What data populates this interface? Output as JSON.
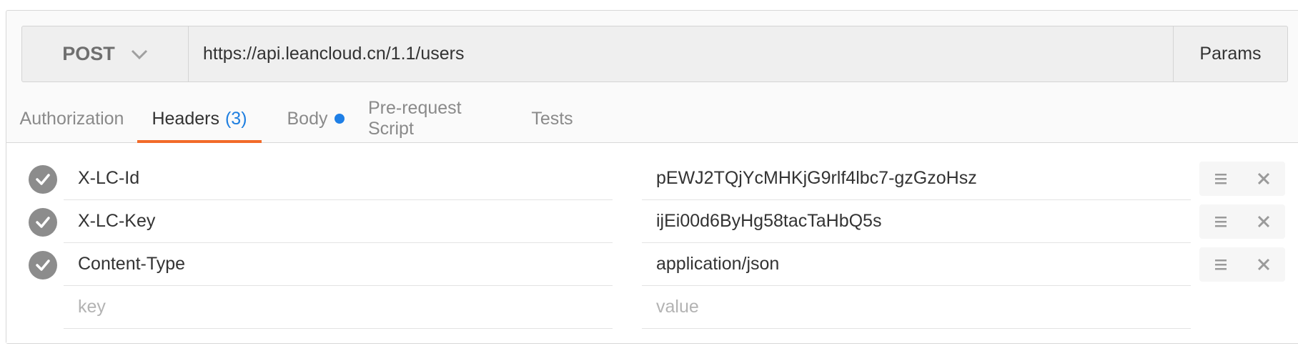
{
  "request": {
    "method": "POST",
    "url": "https://api.leancloud.cn/1.1/users",
    "params_label": "Params"
  },
  "tabs": [
    {
      "label": "Authorization",
      "active": false
    },
    {
      "label": "Headers",
      "count": "(3)",
      "active": true
    },
    {
      "label": "Body",
      "indicator": "dot",
      "active": false
    },
    {
      "label": "Pre-request Script",
      "active": false
    },
    {
      "label": "Tests",
      "active": false
    }
  ],
  "headers": [
    {
      "key": "X-LC-Id",
      "value": "pEWJ2TQjYcMHKjG9rlf4lbc7-gzGzoHsz",
      "enabled": true
    },
    {
      "key": "X-LC-Key",
      "value": "ijEi00d6ByHg58tacTaHbQ5s",
      "enabled": true
    },
    {
      "key": "Content-Type",
      "value": "application/json",
      "enabled": true
    }
  ],
  "new_header": {
    "key_placeholder": "key",
    "value_placeholder": "value"
  },
  "icons": {
    "method_dropdown": "chevron-down-icon",
    "enabled": "checkmark-icon",
    "reorder": "drag-handle-icon",
    "remove": "close-icon"
  },
  "colors": {
    "active_tab_underline": "#f26b29",
    "count_text": "#1f7fe0",
    "body_indicator": "#1e7fe6",
    "check_circle": "#8c8c8c"
  }
}
